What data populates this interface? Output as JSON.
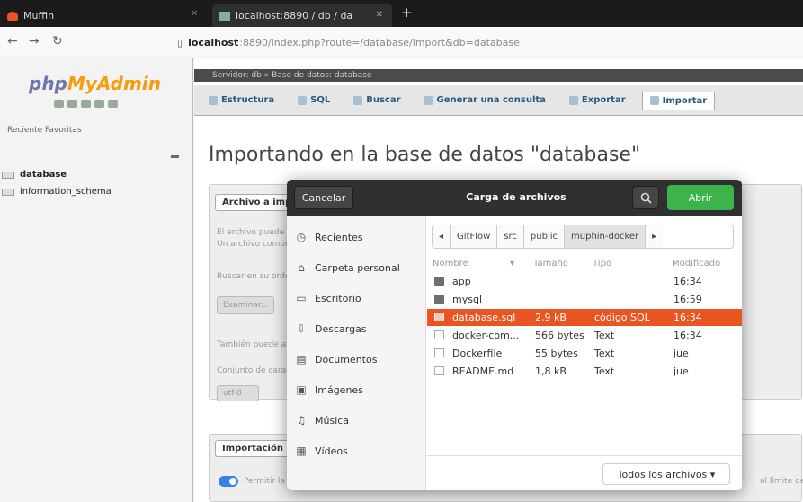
{
  "browser": {
    "app_tab": "Muffin",
    "active_tab": "localhost:8890 / db / da",
    "new_tab": "+",
    "url_host": "localhost",
    "url_path": ":8890/index.php?route=/database/import&db=database"
  },
  "pma": {
    "logo_php": "php",
    "logo_myadmin": "MyAdmin",
    "links": "Reciente   Favoritas",
    "databases": [
      "database",
      "information_schema"
    ],
    "breadcrumb": "Servidor: db  »  Base de datos: database",
    "tabs": [
      "Estructura",
      "SQL",
      "Buscar",
      "Generar una consulta",
      "Exportar",
      "Importar"
    ],
    "title": "Importando en la base de datos \"database\"",
    "section_file": "Archivo a importar:",
    "file_text1": "El archivo puede ser comprimido (gzip, bzip2, zip) o no.",
    "file_text2": "Un archivo comprimido tiene que terminar en .[formato].[compresión].",
    "search_label": "Buscar en su ordenador:",
    "browse_button": "Examinar...",
    "also_text": "También puede arrastrar un archivo en cualquier página.",
    "charset_label": "Conjunto de caracteres del archivo:",
    "charset_value": "utf-8",
    "section_partial": "Importación parcial:",
    "allow_text": "Permitir la interrupción de la importación en caso que el script detecte que se ha acercado al límite de tiempo",
    "limit_text": "al límite de"
  },
  "dialog": {
    "cancel": "Cancelar",
    "title": "Carga de archivos",
    "open": "Abrir",
    "places": [
      {
        "icon": "clock-icon",
        "glyph": "◷",
        "label": "Recientes"
      },
      {
        "icon": "home-icon",
        "glyph": "⌂",
        "label": "Carpeta personal"
      },
      {
        "icon": "desktop-icon",
        "glyph": "▭",
        "label": "Escritorio"
      },
      {
        "icon": "download-icon",
        "glyph": "⇩",
        "label": "Descargas"
      },
      {
        "icon": "documents-icon",
        "glyph": "▤",
        "label": "Documentos"
      },
      {
        "icon": "images-icon",
        "glyph": "▣",
        "label": "Imágenes"
      },
      {
        "icon": "music-icon",
        "glyph": "♫",
        "label": "Música"
      },
      {
        "icon": "videos-icon",
        "glyph": "▦",
        "label": "Vídeos"
      }
    ],
    "path": [
      "GitFlow",
      "src",
      "public",
      "muphin-docker"
    ],
    "columns": {
      "name": "Nombre",
      "size": "Tamaño",
      "type": "Tipo",
      "modified": "Modificado"
    },
    "files": [
      {
        "kind": "folder",
        "name": "app",
        "size": "",
        "type": "",
        "modified": "16:34",
        "selected": false
      },
      {
        "kind": "folder",
        "name": "mysql",
        "size": "",
        "type": "",
        "modified": "16:59",
        "selected": false
      },
      {
        "kind": "doc",
        "name": "database.sql",
        "size": "2,9 kB",
        "type": "código SQL",
        "modified": "16:34",
        "selected": true
      },
      {
        "kind": "doc",
        "name": "docker-com...",
        "size": "566 bytes",
        "type": "Text",
        "modified": "16:34",
        "selected": false
      },
      {
        "kind": "doc",
        "name": "Dockerfile",
        "size": "55 bytes",
        "type": "Text",
        "modified": "jue",
        "selected": false
      },
      {
        "kind": "doc",
        "name": "README.md",
        "size": "1,8 kB",
        "type": "Text",
        "modified": "jue",
        "selected": false
      }
    ],
    "filter": "Todos los archivos ▾"
  },
  "colors": {
    "accent": "#e95420",
    "open_button": "#3cb44a",
    "header": "#303030"
  }
}
